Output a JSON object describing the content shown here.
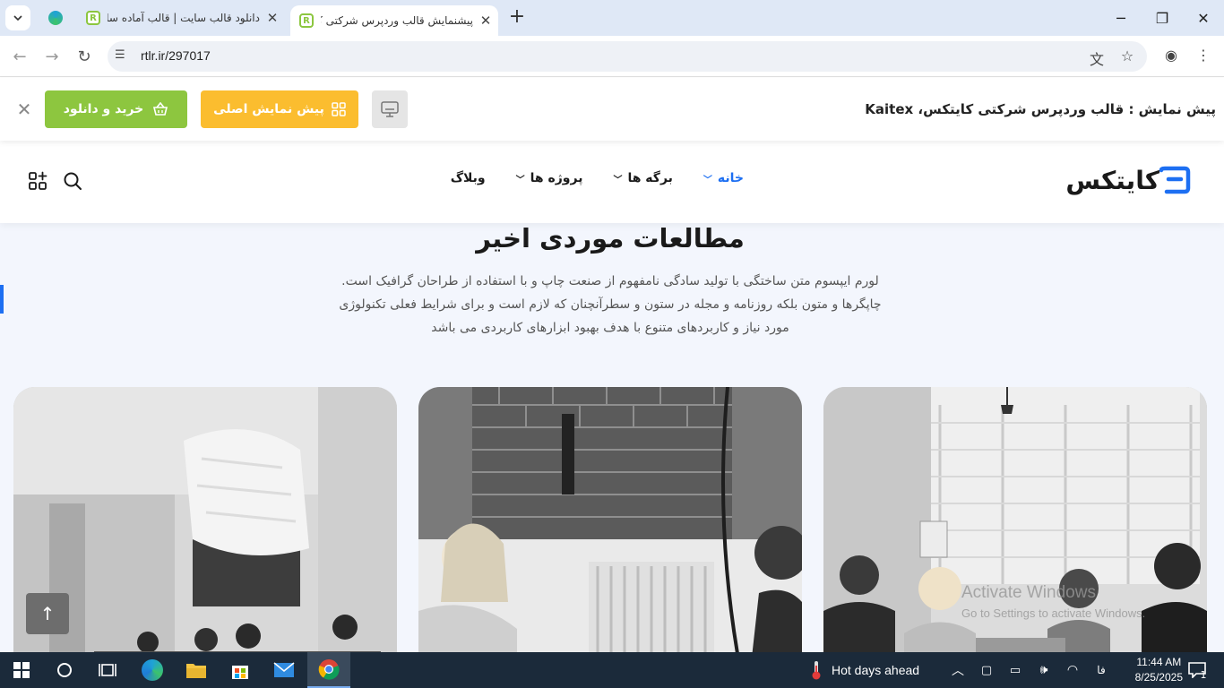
{
  "browser": {
    "tabs": [
      {
        "title": "",
        "favicon": "edge-icon",
        "pinned": true
      },
      {
        "title": "دانلود قالب سایت | قالب آماده سا",
        "favicon": "rtl-icon"
      },
      {
        "title": "پیشنمایش قالب وردپرس شرکتی کا",
        "favicon": "rtl-icon",
        "active": true
      }
    ],
    "url": "rtlr.ir/297017"
  },
  "preview_bar": {
    "title": "پیش نمایش : قالب وردپرس شرکتی کایتکس، Kaitex",
    "buy_label": "خرید و دانلود",
    "demo_label": "پیش نمایش اصلی",
    "colors": {
      "buy": "#8dc63f",
      "demo": "#fbbd2f"
    }
  },
  "site": {
    "logo_text": "کایتکس",
    "nav": [
      {
        "label": "خانه",
        "has_dropdown": true,
        "active": true
      },
      {
        "label": "برگه ها",
        "has_dropdown": true
      },
      {
        "label": "پروژه ها",
        "has_dropdown": true
      },
      {
        "label": "وبلاگ",
        "has_dropdown": false
      }
    ],
    "accent": "#1d6ff2"
  },
  "section": {
    "title": "مطالعات موردی اخیر",
    "description_lines": [
      "لورم ایپسوم متن ساختگی با تولید سادگی نامفهوم از صنعت چاپ و با استفاده از طراحان گرافیک است.",
      "چاپگرها و متون بلکه روزنامه و مجله در ستون و سطرآنچنان که لازم است و برای شرایط فعلی تکنولوژی",
      "مورد نیاز و کاربردهای متنوع با هدف بهبود ابزارهای کاربردی می باشد"
    ]
  },
  "watermark": {
    "line1": "Activate Windows",
    "line2": "Go to Settings to activate Windows."
  },
  "taskbar": {
    "weather": "Hot days ahead",
    "language": "فا",
    "time": "11:44 AM",
    "date": "8/25/2025",
    "notification_count": "1"
  }
}
